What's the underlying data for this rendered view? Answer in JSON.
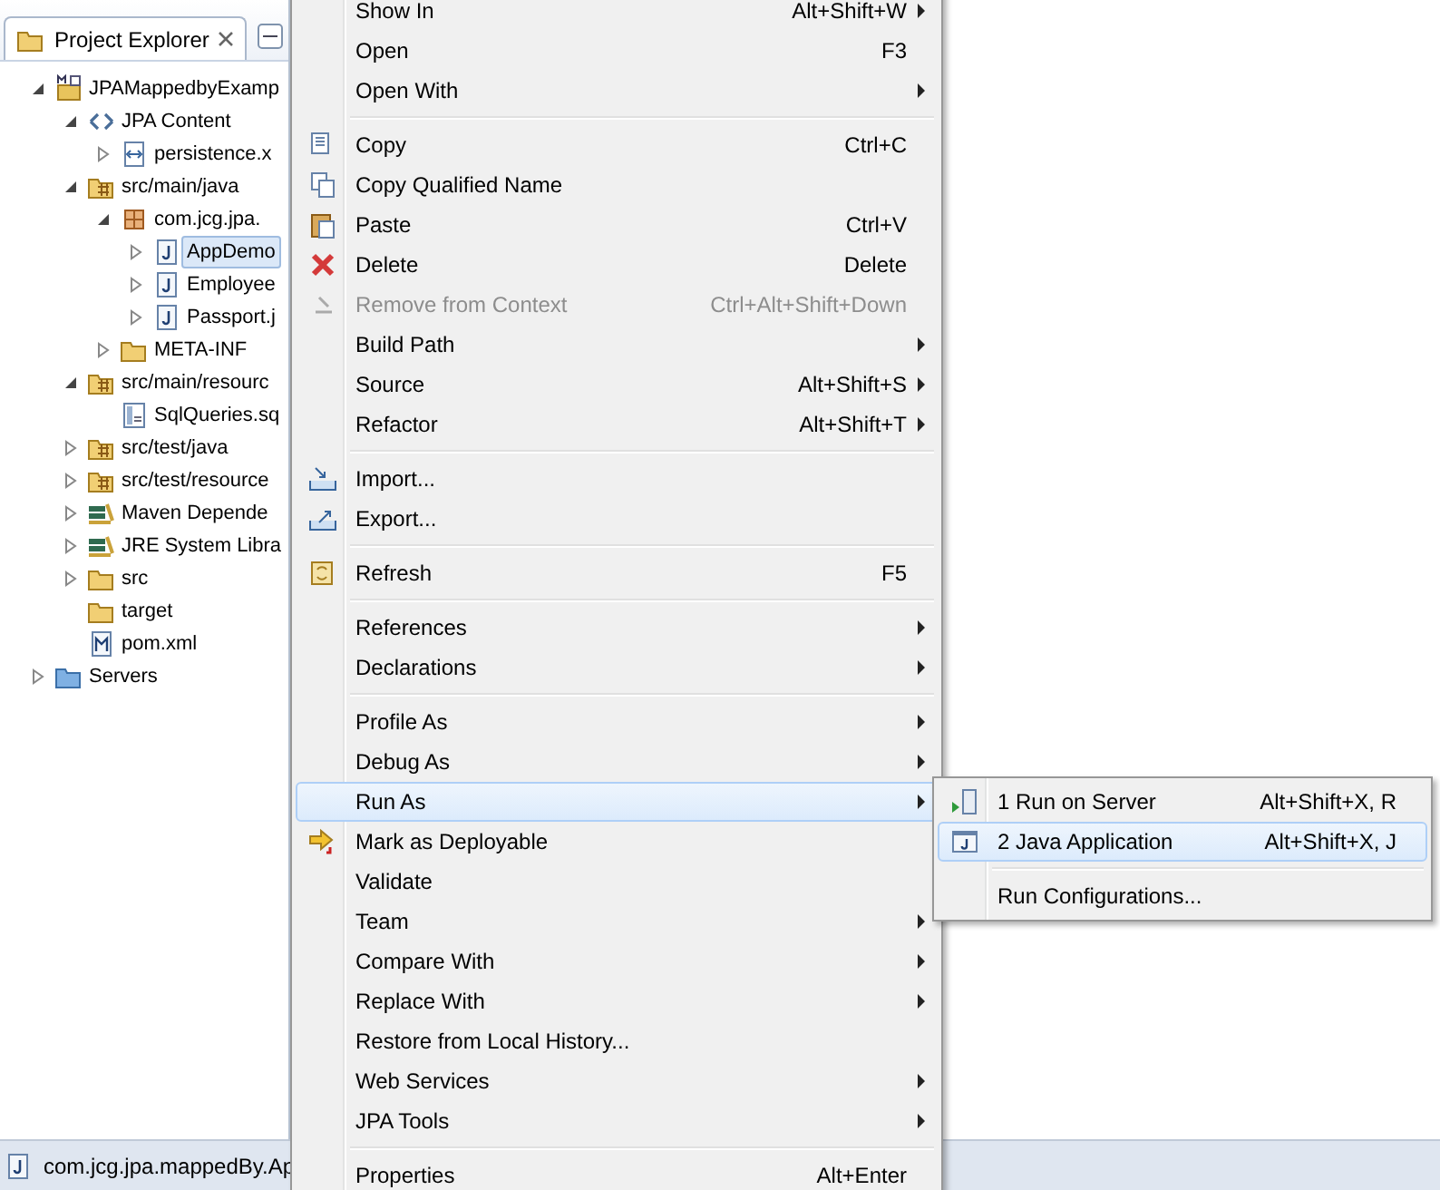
{
  "explorer": {
    "tab": {
      "title": "Project Explorer",
      "selected": true
    },
    "tree": [
      {
        "label": "JPAMappedbyExamp",
        "kind": "project",
        "expanded": true,
        "children": [
          {
            "label": "JPA Content",
            "kind": "jpa",
            "expanded": true,
            "children": [
              {
                "label": "persistence.x",
                "kind": "xml",
                "expanded": false
              }
            ]
          },
          {
            "label": "src/main/java",
            "kind": "source-folder",
            "expanded": true,
            "children": [
              {
                "label": "com.jcg.jpa.",
                "kind": "package",
                "expanded": true,
                "children": [
                  {
                    "label": "AppDemo",
                    "kind": "java",
                    "expanded": false,
                    "selected": true
                  },
                  {
                    "label": "Employee",
                    "kind": "java",
                    "expanded": false,
                    "selected": false
                  },
                  {
                    "label": "Passport.j",
                    "kind": "java",
                    "expanded": false,
                    "selected": false
                  }
                ]
              },
              {
                "label": "META-INF",
                "kind": "folder",
                "expanded": false
              }
            ]
          },
          {
            "label": "src/main/resourc",
            "kind": "source-folder",
            "expanded": true,
            "children": [
              {
                "label": "SqlQueries.sq",
                "kind": "file"
              }
            ]
          },
          {
            "label": "src/test/java",
            "kind": "source-folder",
            "expanded": false
          },
          {
            "label": "src/test/resource",
            "kind": "source-folder",
            "expanded": false
          },
          {
            "label": "Maven Depende",
            "kind": "library",
            "expanded": false
          },
          {
            "label": "JRE System Libra",
            "kind": "library",
            "expanded": false
          },
          {
            "label": "src",
            "kind": "folder",
            "expanded": false
          },
          {
            "label": "target",
            "kind": "folder"
          },
          {
            "label": "pom.xml",
            "kind": "maven"
          }
        ]
      },
      {
        "label": "Servers",
        "kind": "servers",
        "expanded": false
      }
    ]
  },
  "context_menu": {
    "items": [
      {
        "kind": "item",
        "label": "Show In",
        "shortcut": "Alt+Shift+W",
        "submenu": true,
        "disabled": false,
        "selected": false
      },
      {
        "kind": "item",
        "label": "Open",
        "shortcut": "F3",
        "submenu": false,
        "disabled": false,
        "selected": false
      },
      {
        "kind": "item",
        "label": "Open With",
        "submenu": true,
        "disabled": false,
        "selected": false
      },
      {
        "kind": "separator"
      },
      {
        "kind": "item",
        "label": "Copy",
        "shortcut": "Ctrl+C",
        "submenu": false,
        "disabled": false,
        "selected": false
      },
      {
        "kind": "item",
        "label": "Copy Qualified Name",
        "submenu": false,
        "disabled": false,
        "selected": false
      },
      {
        "kind": "item",
        "label": "Paste",
        "shortcut": "Ctrl+V",
        "submenu": false,
        "disabled": false,
        "selected": false
      },
      {
        "kind": "item",
        "label": "Delete",
        "shortcut": "Delete",
        "submenu": false,
        "disabled": false,
        "selected": false
      },
      {
        "kind": "item",
        "label": "Remove from Context",
        "shortcut": "Ctrl+Alt+Shift+Down",
        "submenu": false,
        "disabled": true,
        "selected": false
      },
      {
        "kind": "item",
        "label": "Build Path",
        "submenu": true,
        "disabled": false,
        "selected": false
      },
      {
        "kind": "item",
        "label": "Source",
        "shortcut": "Alt+Shift+S",
        "submenu": true,
        "disabled": false,
        "selected": false
      },
      {
        "kind": "item",
        "label": "Refactor",
        "shortcut": "Alt+Shift+T",
        "submenu": true,
        "disabled": false,
        "selected": false
      },
      {
        "kind": "separator"
      },
      {
        "kind": "item",
        "label": "Import...",
        "submenu": false,
        "disabled": false,
        "selected": false
      },
      {
        "kind": "item",
        "label": "Export...",
        "submenu": false,
        "disabled": false,
        "selected": false
      },
      {
        "kind": "separator"
      },
      {
        "kind": "item",
        "label": "Refresh",
        "shortcut": "F5",
        "submenu": false,
        "disabled": false,
        "selected": false
      },
      {
        "kind": "separator"
      },
      {
        "kind": "item",
        "label": "References",
        "submenu": true,
        "disabled": false,
        "selected": false
      },
      {
        "kind": "item",
        "label": "Declarations",
        "submenu": true,
        "disabled": false,
        "selected": false
      },
      {
        "kind": "separator"
      },
      {
        "kind": "item",
        "label": "Profile As",
        "submenu": true,
        "disabled": false,
        "selected": false
      },
      {
        "kind": "item",
        "label": "Debug As",
        "submenu": true,
        "disabled": false,
        "selected": false
      },
      {
        "kind": "item",
        "label": "Run As",
        "submenu": true,
        "disabled": false,
        "selected": true
      },
      {
        "kind": "item",
        "label": "Mark as Deployable",
        "submenu": false,
        "disabled": false,
        "selected": false
      },
      {
        "kind": "item",
        "label": "Validate",
        "submenu": false,
        "disabled": false,
        "selected": false
      },
      {
        "kind": "item",
        "label": "Team",
        "submenu": true,
        "disabled": false,
        "selected": false
      },
      {
        "kind": "item",
        "label": "Compare With",
        "submenu": true,
        "disabled": false,
        "selected": false
      },
      {
        "kind": "item",
        "label": "Replace With",
        "submenu": true,
        "disabled": false,
        "selected": false
      },
      {
        "kind": "item",
        "label": "Restore from Local History...",
        "submenu": false,
        "disabled": false,
        "selected": false
      },
      {
        "kind": "item",
        "label": "Web Services",
        "submenu": true,
        "disabled": false,
        "selected": false
      },
      {
        "kind": "item",
        "label": "JPA Tools",
        "submenu": true,
        "disabled": false,
        "selected": false
      },
      {
        "kind": "separator"
      },
      {
        "kind": "item",
        "label": "Properties",
        "shortcut": "Alt+Enter",
        "submenu": false,
        "disabled": false,
        "selected": false
      }
    ]
  },
  "run_as_submenu": {
    "items": [
      {
        "kind": "item",
        "label": "1 Run on Server",
        "shortcut": "Alt+Shift+X, R",
        "selected": false
      },
      {
        "kind": "item",
        "label": "2 Java Application",
        "shortcut": "Alt+Shift+X, J",
        "selected": true
      },
      {
        "kind": "separator"
      },
      {
        "kind": "item",
        "label": "Run Configurations...",
        "selected": false
      }
    ]
  },
  "status_bar": {
    "text": "com.jcg.jpa.mappedBy.Ap"
  }
}
